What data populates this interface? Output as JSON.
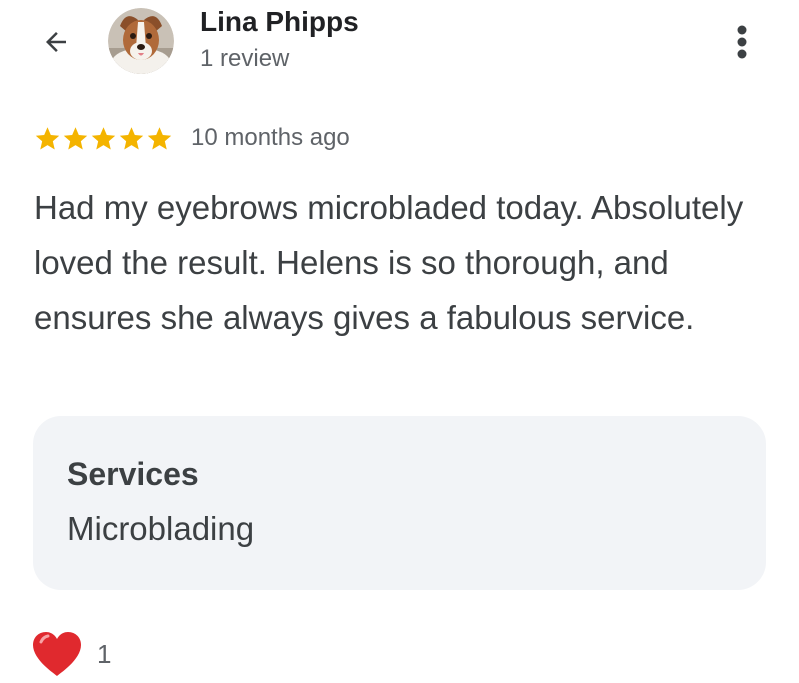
{
  "reviewer": {
    "name": "Lina Phipps",
    "review_count": "1 review"
  },
  "review": {
    "rating": 5,
    "rating_max": 5,
    "date": "10 months ago",
    "text": "Had my eyebrows microbladed today. Absolutely loved the result. Helens is so thorough, and ensures she always gives a fabulous service."
  },
  "services": {
    "heading": "Services",
    "value": "Microblading"
  },
  "reactions": {
    "heart_count": "1"
  },
  "icons": {
    "back": "arrow-back-icon",
    "more": "more-vert-icon",
    "star": "star-icon",
    "heart": "heart-icon"
  },
  "colors": {
    "star": "#f4b400",
    "heart": "#e0292e",
    "card_background": "#f2f4f7",
    "secondary_text": "#5f6368",
    "body_text": "#3c4043"
  }
}
